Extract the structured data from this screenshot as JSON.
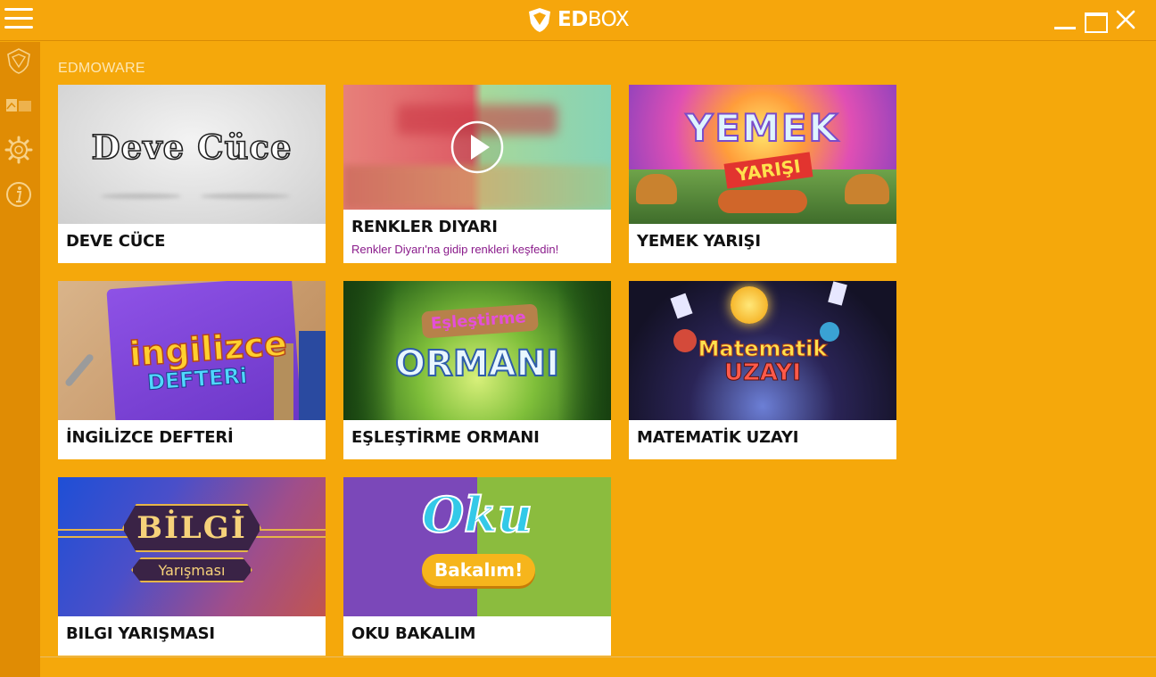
{
  "window": {
    "logo_text_bold": "ED",
    "logo_text_thin": "BOX",
    "controls": [
      "minimize",
      "maximize",
      "close"
    ]
  },
  "sidebar": {
    "items": [
      {
        "icon": "edbox-shield-icon"
      },
      {
        "icon": "library-icon"
      },
      {
        "icon": "gear-icon"
      },
      {
        "icon": "info-icon"
      }
    ]
  },
  "main": {
    "section_title": "EDMOWARE",
    "cards": [
      {
        "title": "DEVE CÜCE",
        "thumb_text": "Deve Cüce",
        "type": "game"
      },
      {
        "title": "RENKLER DIYARI",
        "subtitle": "Renkler Diyarı'na gidip renkleri keşfedin!",
        "type": "video"
      },
      {
        "title": "YEMEK YARIŞI",
        "thumb_text": "YEMEK",
        "thumb_text_2": "YARIŞI",
        "type": "game"
      },
      {
        "title": "İNGİLİZCE DEFTERİ",
        "thumb_text": "ingilizce",
        "thumb_text_2": "DEFTERi",
        "type": "game"
      },
      {
        "title": "EŞLEŞTİRME ORMANI",
        "thumb_text": "Eşleştirme",
        "thumb_text_2": "ORMANI",
        "type": "game"
      },
      {
        "title": "MATEMATİK UZAYI",
        "thumb_text": "Matematik",
        "thumb_text_2": "UZAYI",
        "type": "game"
      },
      {
        "title": "BILGI YARIŞMASI",
        "thumb_text": "BİLGİ",
        "thumb_text_2": "Yarışması",
        "type": "game"
      },
      {
        "title": "OKU BAKALIM",
        "thumb_text": "Oku",
        "thumb_text_2": "Bakalım!",
        "type": "game"
      }
    ]
  },
  "colors": {
    "background": "#f5a80b",
    "sidebar": "#e08c04",
    "subtitle": "#8a1b8b"
  }
}
